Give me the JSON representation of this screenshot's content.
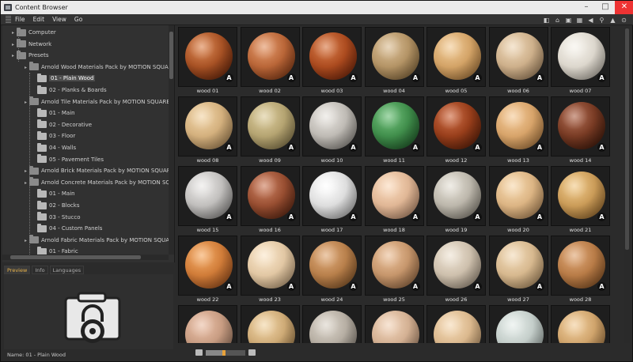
{
  "window": {
    "title": "Content Browser"
  },
  "menu": [
    "File",
    "Edit",
    "View",
    "Go"
  ],
  "tree": [
    {
      "label": "Computer",
      "level": 0,
      "icon": "computer-icon"
    },
    {
      "label": "Network",
      "level": 0,
      "icon": "network-icon"
    },
    {
      "label": "Presets",
      "level": 0,
      "icon": "presets-icon"
    },
    {
      "label": "Arnold Wood Materials Pack by MOTION SQUARED",
      "level": 1,
      "icon": "folder-icon"
    },
    {
      "label": "01 - Plain Wood",
      "level": 2,
      "icon": "folder-icon",
      "selected": true
    },
    {
      "label": "02 - Planks & Boards",
      "level": 2,
      "icon": "folder-icon"
    },
    {
      "label": "Arnold Tile Materials Pack by MOTION SQUARED",
      "level": 1,
      "icon": "folder-icon"
    },
    {
      "label": "01 - Main",
      "level": 2,
      "icon": "folder-icon"
    },
    {
      "label": "02 - Decorative",
      "level": 2,
      "icon": "folder-icon"
    },
    {
      "label": "03 - Floor",
      "level": 2,
      "icon": "folder-icon"
    },
    {
      "label": "04 - Walls",
      "level": 2,
      "icon": "folder-icon"
    },
    {
      "label": "05 - Pavement Tiles",
      "level": 2,
      "icon": "folder-icon"
    },
    {
      "label": "Arnold Brick Materials Pack by MOTION SQUARED",
      "level": 1,
      "icon": "folder-icon"
    },
    {
      "label": "Arnold Concrete Materials Pack by MOTION SQUARED",
      "level": 1,
      "icon": "folder-icon"
    },
    {
      "label": "01 - Main",
      "level": 2,
      "icon": "folder-icon"
    },
    {
      "label": "02 - Blocks",
      "level": 2,
      "icon": "folder-icon"
    },
    {
      "label": "03 - Stucco",
      "level": 2,
      "icon": "folder-icon"
    },
    {
      "label": "04 - Custom Panels",
      "level": 2,
      "icon": "folder-icon"
    },
    {
      "label": "Arnold Fabric Materials Pack by MOTION SQUARED",
      "level": 1,
      "icon": "folder-icon"
    },
    {
      "label": "01 - Fabric",
      "level": 2,
      "icon": "folder-icon"
    }
  ],
  "tabs": [
    "Preview",
    "Info",
    "Languages"
  ],
  "status": {
    "name_label": "Name: 01 - Plain Wood"
  },
  "materials": [
    {
      "name": "wood 01",
      "c1": "#d9783c",
      "c2": "#6a2308"
    },
    {
      "name": "wood 02",
      "c1": "#e08a55",
      "c2": "#8a3a14"
    },
    {
      "name": "wood 03",
      "c1": "#d46a30",
      "c2": "#7a250a"
    },
    {
      "name": "wood 04",
      "c1": "#d6b688",
      "c2": "#8a6a3c"
    },
    {
      "name": "wood 05",
      "c1": "#f0c58a",
      "c2": "#b07a3c"
    },
    {
      "name": "wood 06",
      "c1": "#ecd2ae",
      "c2": "#a88660"
    },
    {
      "name": "wood 07",
      "c1": "#f6f2ea",
      "c2": "#bdb6aa"
    },
    {
      "name": "wood 08",
      "c1": "#f0cf9c",
      "c2": "#b08a58"
    },
    {
      "name": "wood 09",
      "c1": "#d8c690",
      "c2": "#8a7a4c"
    },
    {
      "name": "wood 10",
      "c1": "#e6e2dc",
      "c2": "#8e8a84"
    },
    {
      "name": "wood 11",
      "c1": "#5cb868",
      "c2": "#1e5a28"
    },
    {
      "name": "wood 12",
      "c1": "#c8582a",
      "c2": "#5c1e08"
    },
    {
      "name": "wood 13",
      "c1": "#f4c48c",
      "c2": "#b47c40"
    },
    {
      "name": "wood 14",
      "c1": "#a8583a",
      "c2": "#3c1608"
    },
    {
      "name": "wood 15",
      "c1": "#eae8e6",
      "c2": "#8e8c8a"
    },
    {
      "name": "wood 16",
      "c1": "#c8704c",
      "c2": "#5c2410"
    },
    {
      "name": "wood 17",
      "c1": "#ffffff",
      "c2": "#b4b4b4"
    },
    {
      "name": "wood 18",
      "c1": "#fad6b4",
      "c2": "#c09070"
    },
    {
      "name": "wood 19",
      "c1": "#e2ddd2",
      "c2": "#8e887c"
    },
    {
      "name": "wood 20",
      "c1": "#f6d4a4",
      "c2": "#bc8e5c"
    },
    {
      "name": "wood 21",
      "c1": "#f0c47c",
      "c2": "#9c6a2c"
    },
    {
      "name": "wood 22",
      "c1": "#f4a050",
      "c2": "#a4501c"
    },
    {
      "name": "wood 23",
      "c1": "#fae4c4",
      "c2": "#c4a47c"
    },
    {
      "name": "wood 24",
      "c1": "#dca068",
      "c2": "#8c5828"
    },
    {
      "name": "wood 25",
      "c1": "#e8b88c",
      "c2": "#9c6c44"
    },
    {
      "name": "wood 26",
      "c1": "#ece0ce",
      "c2": "#a89884"
    },
    {
      "name": "wood 27",
      "c1": "#f0d6b0",
      "c2": "#b89466"
    },
    {
      "name": "wood 28",
      "c1": "#dc9c64",
      "c2": "#8c5424"
    },
    {
      "name": "",
      "c1": "#e8b89c",
      "c2": "#a07a62"
    },
    {
      "name": "",
      "c1": "#f0d09c",
      "c2": "#a47c48"
    },
    {
      "name": "",
      "c1": "#d8d0c4",
      "c2": "#8c847a"
    },
    {
      "name": "",
      "c1": "#f0cfb2",
      "c2": "#b08a6c"
    },
    {
      "name": "",
      "c1": "#f4d6ae",
      "c2": "#bc9466"
    },
    {
      "name": "",
      "c1": "#e4ece8",
      "c2": "#9ca8a4"
    },
    {
      "name": "",
      "c1": "#f0c890",
      "c2": "#a87840"
    }
  ],
  "colors": {
    "accent": "#e8a23a",
    "selection": "#4d4d4d",
    "background": "#2b2b2b"
  },
  "zoom": {
    "level": 0.45
  }
}
